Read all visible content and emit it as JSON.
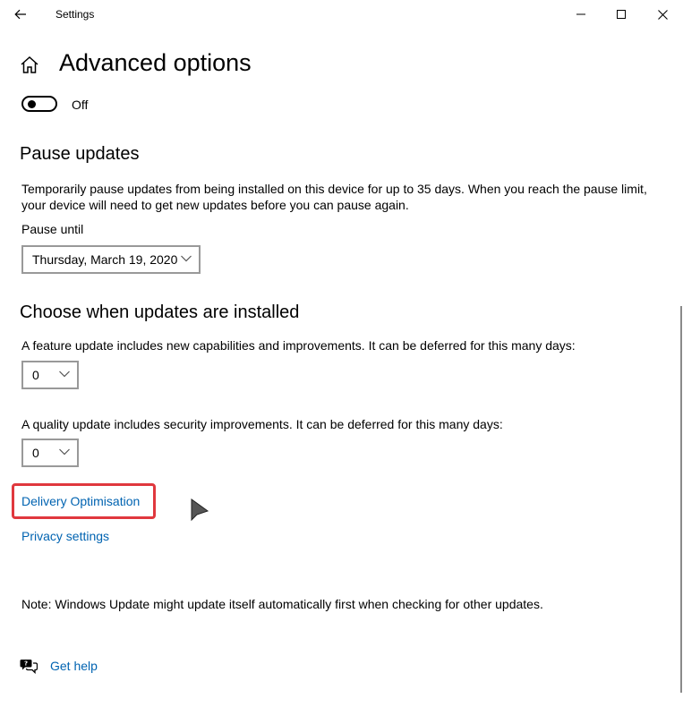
{
  "window": {
    "title": "Settings",
    "back_icon": "back-arrow-icon",
    "minimize_icon": "minimize-icon",
    "maximize_icon": "maximize-icon",
    "close_icon": "close-icon"
  },
  "page": {
    "home_icon": "home-icon",
    "title": "Advanced options"
  },
  "toggle": {
    "state_label": "Off",
    "is_on": false
  },
  "pause_updates": {
    "heading": "Pause updates",
    "description_line1": "Temporarily pause updates from being installed on this device for up to 35 days. When you reach the pause limit,",
    "description_line2": "your device will need to get new updates before you can pause again.",
    "pause_until_label": "Pause until",
    "pause_until_value": "Thursday, March 19, 2020"
  },
  "choose_when": {
    "heading": "Choose when updates are installed",
    "feature_description": "A feature update includes new capabilities and improvements. It can be deferred for this many days:",
    "feature_value": "0",
    "quality_description": "A quality update includes security improvements. It can be deferred for this many days:",
    "quality_value": "0"
  },
  "links": {
    "delivery_optimisation": "Delivery Optimisation",
    "privacy_settings": "Privacy settings"
  },
  "note": "Note: Windows Update might update itself automatically first when checking for other updates.",
  "help": {
    "icon": "get-help-icon",
    "label": "Get help"
  },
  "colors": {
    "accent_link": "#0063b1",
    "highlight_box": "#e0383e",
    "dropdown_border": "#999999"
  }
}
